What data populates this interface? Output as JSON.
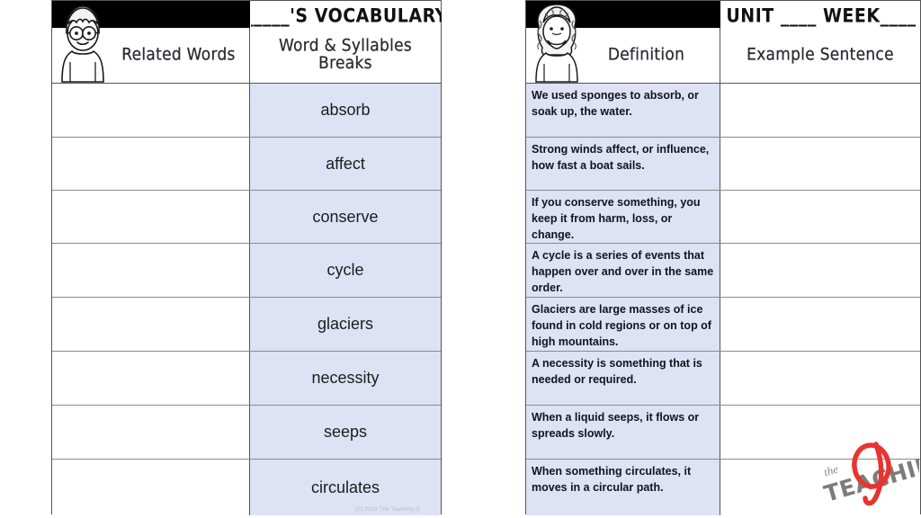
{
  "left_sheet": {
    "title": "_____'S VOCABULARY",
    "columns": {
      "related_words": "Related Words",
      "word_syllables": "Word & Syllables Breaks"
    },
    "avatar": "boy-with-glasses-avatar",
    "rows": [
      {
        "related_words": "",
        "word": "absorb"
      },
      {
        "related_words": "",
        "word": "affect"
      },
      {
        "related_words": "",
        "word": "conserve"
      },
      {
        "related_words": "",
        "word": "cycle"
      },
      {
        "related_words": "",
        "word": "glaciers"
      },
      {
        "related_words": "",
        "word": "necessity"
      },
      {
        "related_words": "",
        "word": "seeps"
      },
      {
        "related_words": "",
        "word": "circulates"
      }
    ]
  },
  "right_sheet": {
    "title": "UNIT ____ WEEK____",
    "columns": {
      "definition": "Definition",
      "example_sentence": "Example Sentence"
    },
    "avatar": "girl-with-curly-hair-avatar",
    "rows": [
      {
        "definition": "We used sponges to absorb, or soak up, the water.",
        "example_sentence": ""
      },
      {
        "definition": "Strong winds affect, or influence, how fast a boat sails.",
        "example_sentence": ""
      },
      {
        "definition": "If you conserve something, you keep it from harm, loss, or change.",
        "example_sentence": ""
      },
      {
        "definition": "A cycle is a series of events that happen over and over in the same order.",
        "example_sentence": ""
      },
      {
        "definition": "Glaciers are large masses of ice found in cold regions or on top of high mountains.",
        "example_sentence": ""
      },
      {
        "definition": "A necessity is something that is needed or required.",
        "example_sentence": ""
      },
      {
        "definition": "When a liquid seeps, it flows or spreads slowly.",
        "example_sentence": ""
      },
      {
        "definition": "When something circulates, it moves in a circular path.",
        "example_sentence": ""
      }
    ]
  },
  "footer": {
    "copyright": "(C) 2019 The Teaching Q"
  },
  "watermark": {
    "the": "the",
    "teaching": "TEACHING",
    "mark": "Q",
    "mark_color": "#e8342f",
    "text_color": "#7c7c7c"
  },
  "colors": {
    "highlight_fill": "#dde2f5",
    "header_bar": "#000000",
    "grid_line": "#8b8b8b",
    "border": "#555555"
  }
}
